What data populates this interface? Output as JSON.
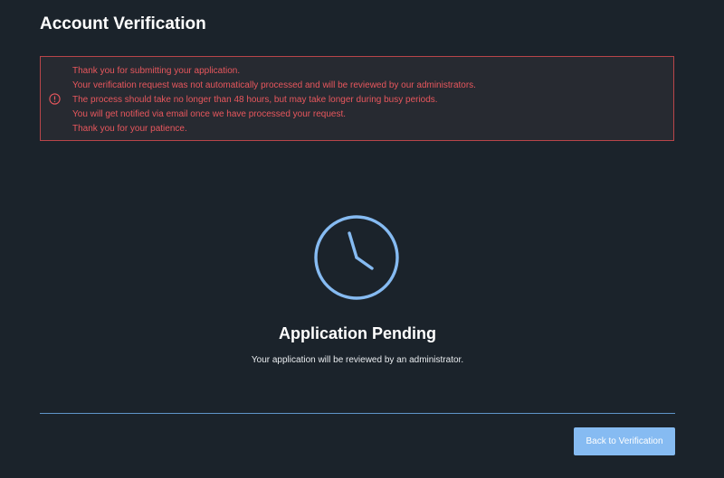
{
  "page": {
    "title": "Account Verification"
  },
  "alert": {
    "icon": "exclamation-circle-icon",
    "color": "#e8575d",
    "lines": [
      "Thank you for submitting your application.",
      "Your verification request was not automatically processed and will be reviewed by our administrators.",
      "The process should take no longer than 48 hours, but may take longer during busy periods.",
      "You will get notified via email once we have processed your request.",
      "Thank you for your patience."
    ]
  },
  "status": {
    "icon": "clock-icon",
    "title": "Application Pending",
    "description": "Your application will be reviewed by an administrator."
  },
  "actions": {
    "back_label": "Back to Verification",
    "accent": "#86bbf2"
  }
}
